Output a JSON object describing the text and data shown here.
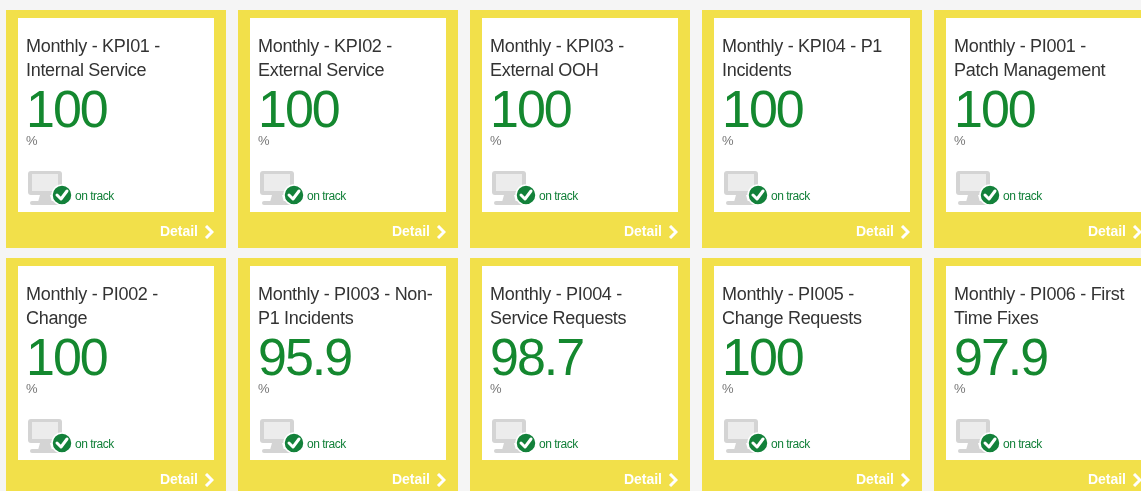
{
  "cards": [
    {
      "title": "Monthly - KPI01 - Internal Service",
      "value": "100",
      "unit": "%",
      "status": {
        "kind": "on_track",
        "label": "on track"
      },
      "link": "Detail"
    },
    {
      "title": "Monthly - KPI02 - External Service",
      "value": "100",
      "unit": "%",
      "status": {
        "kind": "on_track",
        "label": "on track"
      },
      "link": "Detail"
    },
    {
      "title": "Monthly - KPI03 - External OOH",
      "value": "100",
      "unit": "%",
      "status": {
        "kind": "on_track",
        "label": "on track"
      },
      "link": "Detail"
    },
    {
      "title": "Monthly - KPI04 - P1 Incidents",
      "value": "100",
      "unit": "%",
      "status": {
        "kind": "on_track",
        "label": "on track"
      },
      "link": "Detail"
    },
    {
      "title": "Monthly - PI001 - Patch Management",
      "value": "100",
      "unit": "%",
      "status": {
        "kind": "on_track",
        "label": "on track"
      },
      "link": "Detail"
    },
    {
      "title": "Monthly - PI002 - Change",
      "value": "100",
      "unit": "%",
      "status": {
        "kind": "on_track",
        "label": "on track"
      },
      "link": "Detail"
    },
    {
      "title": "Monthly - PI003 - Non-P1 Incidents",
      "value": "95.9",
      "unit": "%",
      "status": {
        "kind": "on_track",
        "label": "on track"
      },
      "link": "Detail"
    },
    {
      "title": "Monthly - PI004 - Service Requests",
      "value": "98.7",
      "unit": "%",
      "status": {
        "kind": "on_track",
        "label": "on track"
      },
      "link": "Detail"
    },
    {
      "title": "Monthly - PI005 - Change Requests",
      "value": "100",
      "unit": "%",
      "status": {
        "kind": "on_track",
        "label": "on track"
      },
      "link": "Detail"
    },
    {
      "title": "Monthly - PI006 - First Time Fixes",
      "value": "97.9",
      "unit": "%",
      "status": {
        "kind": "on_track",
        "label": "on track"
      },
      "link": "Detail"
    }
  ]
}
